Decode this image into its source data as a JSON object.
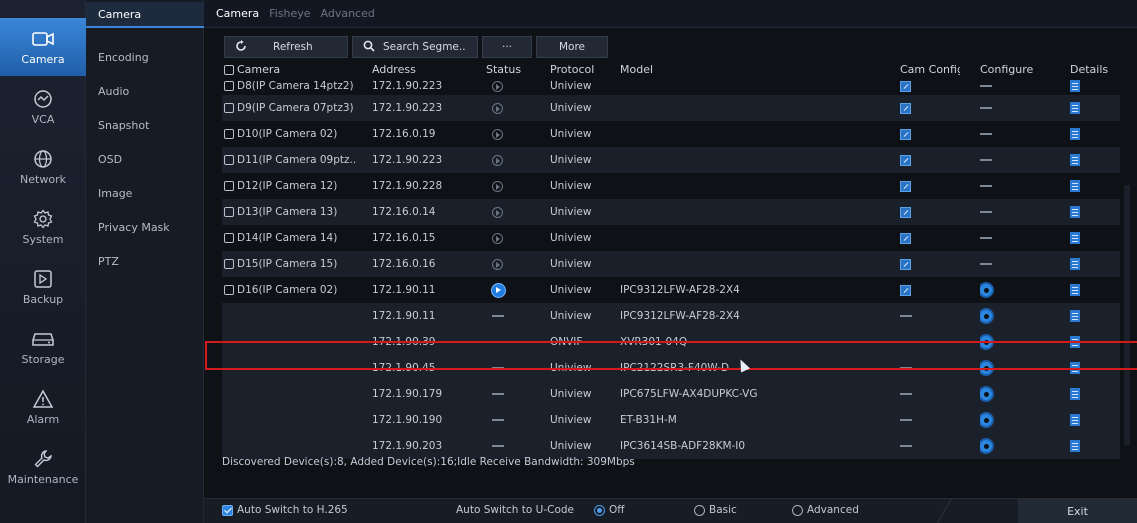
{
  "rail": [
    {
      "label": "Camera",
      "icon": "camera-icon",
      "active": true
    },
    {
      "label": "VCA",
      "icon": "vca-icon"
    },
    {
      "label": "Network",
      "icon": "globe-icon"
    },
    {
      "label": "System",
      "icon": "gear-icon"
    },
    {
      "label": "Backup",
      "icon": "backup-icon"
    },
    {
      "label": "Storage",
      "icon": "storage-icon"
    },
    {
      "label": "Alarm",
      "icon": "alarm-icon"
    },
    {
      "label": "Maintenance",
      "icon": "wrench-icon"
    }
  ],
  "submenu": [
    "Camera",
    "Encoding",
    "Audio",
    "Snapshot",
    "OSD",
    "Image",
    "Privacy Mask",
    "PTZ"
  ],
  "tabs": [
    "Camera",
    "Fisheye",
    "Advanced"
  ],
  "toolbar": {
    "refresh": "Refresh",
    "search": "Search Segme..",
    "dots": "···",
    "more": "More"
  },
  "columns": {
    "camera": "Camera",
    "address": "Address",
    "status": "Status",
    "protocol": "Protocol",
    "model": "Model",
    "cam_config": "Cam Config",
    "configure": "Configure",
    "details": "Details"
  },
  "rows": [
    {
      "camera": "D8(IP Camera 14ptz2)",
      "address": "172.1.90.223",
      "status": "off",
      "protocol": "Uniview",
      "model": "",
      "camcfg": "edit",
      "cfg": "dash"
    },
    {
      "camera": "D9(IP Camera 07ptz3)",
      "address": "172.1.90.223",
      "status": "off",
      "protocol": "Uniview",
      "model": "",
      "camcfg": "edit",
      "cfg": "dash"
    },
    {
      "camera": "D10(IP Camera 02)",
      "address": "172.16.0.19",
      "status": "off",
      "protocol": "Uniview",
      "model": "",
      "camcfg": "edit",
      "cfg": "dash"
    },
    {
      "camera": "D11(IP Camera 09ptz..",
      "address": "172.1.90.223",
      "status": "off",
      "protocol": "Uniview",
      "model": "",
      "camcfg": "edit",
      "cfg": "dash"
    },
    {
      "camera": "D12(IP Camera 12)",
      "address": "172.1.90.228",
      "status": "off",
      "protocol": "Uniview",
      "model": "",
      "camcfg": "edit",
      "cfg": "dash"
    },
    {
      "camera": "D13(IP Camera 13)",
      "address": "172.16.0.14",
      "status": "off",
      "protocol": "Uniview",
      "model": "",
      "camcfg": "edit",
      "cfg": "dash"
    },
    {
      "camera": "D14(IP Camera 14)",
      "address": "172.16.0.15",
      "status": "off",
      "protocol": "Uniview",
      "model": "",
      "camcfg": "edit",
      "cfg": "dash"
    },
    {
      "camera": "D15(IP Camera 15)",
      "address": "172.16.0.16",
      "status": "off",
      "protocol": "Uniview",
      "model": "",
      "camcfg": "edit",
      "cfg": "dash"
    },
    {
      "camera": "D16(IP Camera 02)",
      "address": "172.1.90.11",
      "status": "on",
      "protocol": "Uniview",
      "model": "IPC9312LFW-AF28-2X4",
      "camcfg": "edit",
      "cfg": "gear"
    },
    {
      "camera": "",
      "address": "172.1.90.11",
      "status": "dash",
      "protocol": "Uniview",
      "model": "IPC9312LFW-AF28-2X4",
      "camcfg": "dash",
      "cfg": "gear"
    },
    {
      "camera": "",
      "address": "172.1.90.39",
      "status": "dash",
      "protocol": "ONVIF",
      "model": "XVR301-04Q",
      "camcfg": "dash",
      "cfg": "gear"
    },
    {
      "camera": "",
      "address": "172.1.90.45",
      "status": "dash",
      "protocol": "Uniview",
      "model": "IPC2122SR3-F40W-D",
      "camcfg": "dash",
      "cfg": "gear"
    },
    {
      "camera": "",
      "address": "172.1.90.179",
      "status": "dash",
      "protocol": "Uniview",
      "model": "IPC675LFW-AX4DUPKC-VG",
      "camcfg": "dash",
      "cfg": "gear"
    },
    {
      "camera": "",
      "address": "172.1.90.190",
      "status": "dash",
      "protocol": "Uniview",
      "model": "ET-B31H-M",
      "camcfg": "dash",
      "cfg": "gear"
    },
    {
      "camera": "",
      "address": "172.1.90.203",
      "status": "dash",
      "protocol": "Uniview",
      "model": "IPC3614SB-ADF28KM-I0",
      "camcfg": "dash",
      "cfg": "gear"
    }
  ],
  "summary": "Discovered Device(s):8, Added Device(s):16;Idle Receive Bandwidth: 309Mbps",
  "bottom": {
    "h265": "Auto Switch to H.265",
    "ucode": "Auto Switch to U-Code",
    "off": "Off",
    "basic": "Basic",
    "advanced": "Advanced",
    "exit": "Exit"
  },
  "colors": {
    "accent": "#3b86d8",
    "highlight": "#d41a1a"
  }
}
